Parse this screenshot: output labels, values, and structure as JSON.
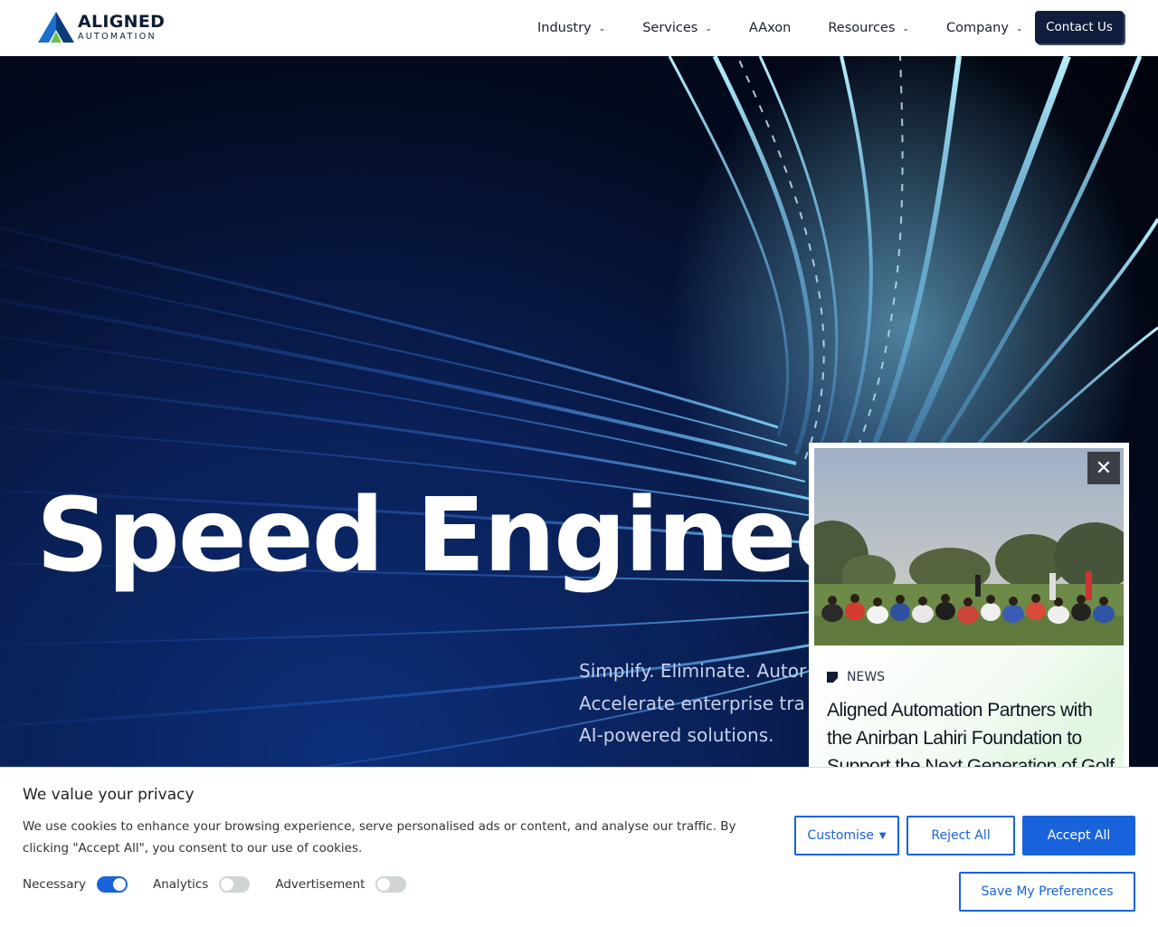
{
  "brand": {
    "name": "ALIGNED",
    "tagline": "AUTOMATION",
    "colors": {
      "navy": "#0d1b33",
      "blue": "#1a6fd1",
      "green": "#6cc04a"
    }
  },
  "nav": {
    "items": [
      {
        "label": "Industry",
        "dropdown": true
      },
      {
        "label": "Services",
        "dropdown": true
      },
      {
        "label": "AAxon",
        "dropdown": false
      },
      {
        "label": "Resources",
        "dropdown": true
      },
      {
        "label": "Company",
        "dropdown": true
      }
    ],
    "contact_label": "Contact Us"
  },
  "hero": {
    "title": "Speed Engineer",
    "subtitle_lines": [
      "Simplify. Eliminate. Autor",
      "Accelerate enterprise tra",
      "AI-powered solutions."
    ]
  },
  "news": {
    "tag": "NEWS",
    "headline": "Aligned Automation Partners with the Anirban Lahiri Foundation to Support the Next Generation of Golf",
    "close_icon": "close-icon"
  },
  "cookie": {
    "title": "We value your privacy",
    "text": "We use cookies to enhance your browsing experience, serve personalised ads or content, and analyse our traffic. By clicking \"Accept All\", you consent to our use of cookies.",
    "toggles": [
      {
        "label": "Necessary",
        "on": true
      },
      {
        "label": "Analytics",
        "on": false
      },
      {
        "label": "Advertisement",
        "on": false
      }
    ],
    "buttons": {
      "customise": "Customise",
      "reject": "Reject All",
      "accept": "Accept All",
      "save": "Save My Preferences"
    },
    "accent": "#1863dc"
  }
}
